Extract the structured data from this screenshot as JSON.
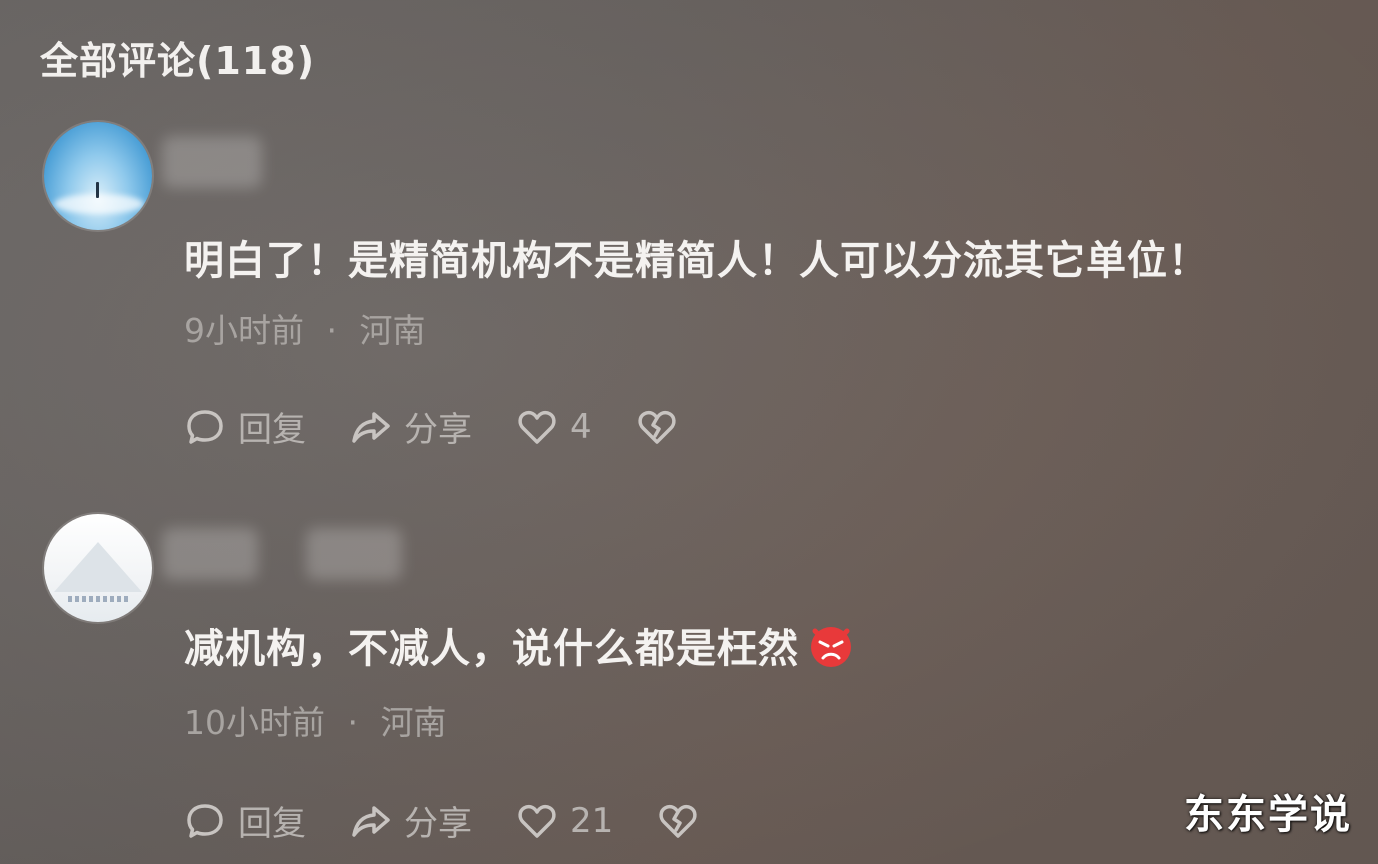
{
  "header": {
    "title": "全部评论(118)"
  },
  "comments": [
    {
      "text": "明白了！是精简机构不是精简人！人可以分流其它单位！",
      "time": "9小时前",
      "separator": "·",
      "location": "河南",
      "reply_label": "回复",
      "share_label": "分享",
      "like_count": "4"
    },
    {
      "text": "减机构，不减人，说什么都是枉然",
      "emoji": "angry-face-icon",
      "time": "10小时前",
      "separator": "·",
      "location": "河南",
      "reply_label": "回复",
      "share_label": "分享",
      "like_count": "21"
    }
  ],
  "watermark": "东东学说",
  "colors": {
    "background": "#6c6561",
    "text": "#f4f2f0",
    "meta": "#a8a4a1",
    "emoji": "#e8393a"
  }
}
